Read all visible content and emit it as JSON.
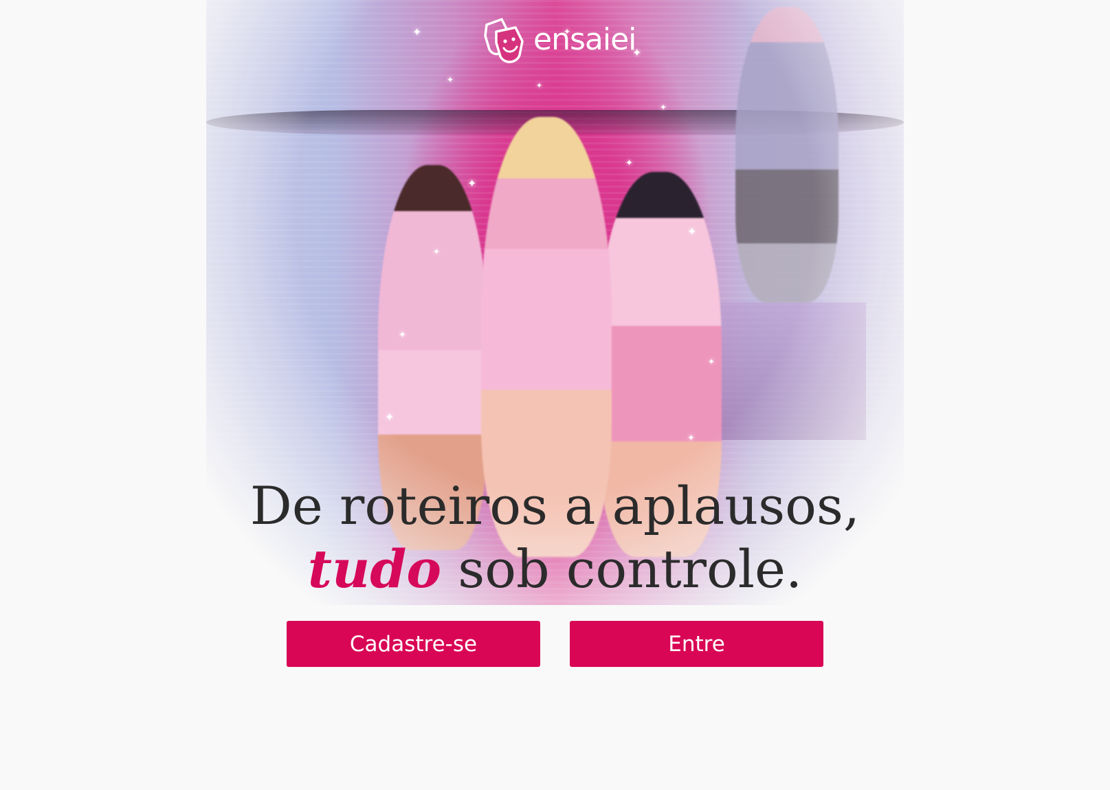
{
  "brand": {
    "name": "ensaiei",
    "logo_icon": "theater-masks-icon"
  },
  "hero": {
    "image": "stage-performance-photo"
  },
  "headline": {
    "line1": "De roteiros a aplausos,",
    "accent": "tudo",
    "line2_rest": "sob controle."
  },
  "actions": {
    "signup_label": "Cadastre-se",
    "login_label": "Entre"
  },
  "colors": {
    "accent": "#d6085a",
    "button": "#d90655",
    "text": "#2b2b2b",
    "background": "#f9f9f9"
  }
}
